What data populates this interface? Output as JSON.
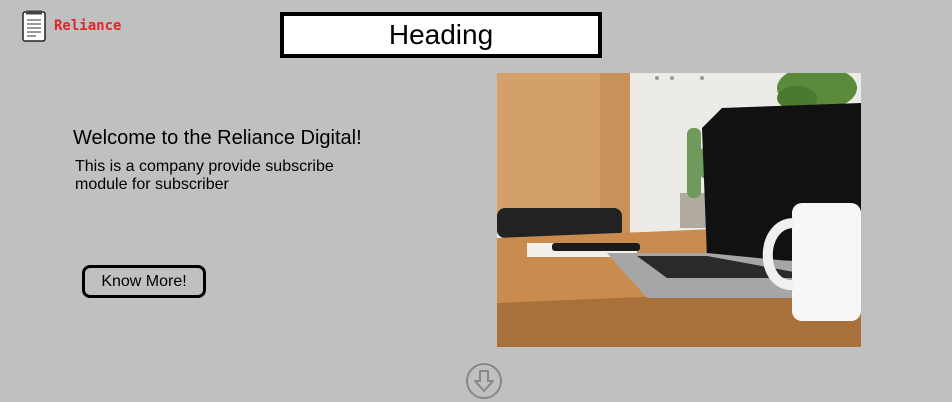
{
  "header": {
    "brand": "Reliance",
    "title": "Heading"
  },
  "hero": {
    "welcome": "Welcome to the Reliance Digital!",
    "description": "This is a company provide subscribe module for subscriber",
    "cta_label": "Know More!"
  },
  "icons": {
    "logo": "notepad-icon",
    "scroll": "arrow-down-circle-icon"
  },
  "colors": {
    "background": "#c0c0c0",
    "brand": "#e3242b"
  }
}
